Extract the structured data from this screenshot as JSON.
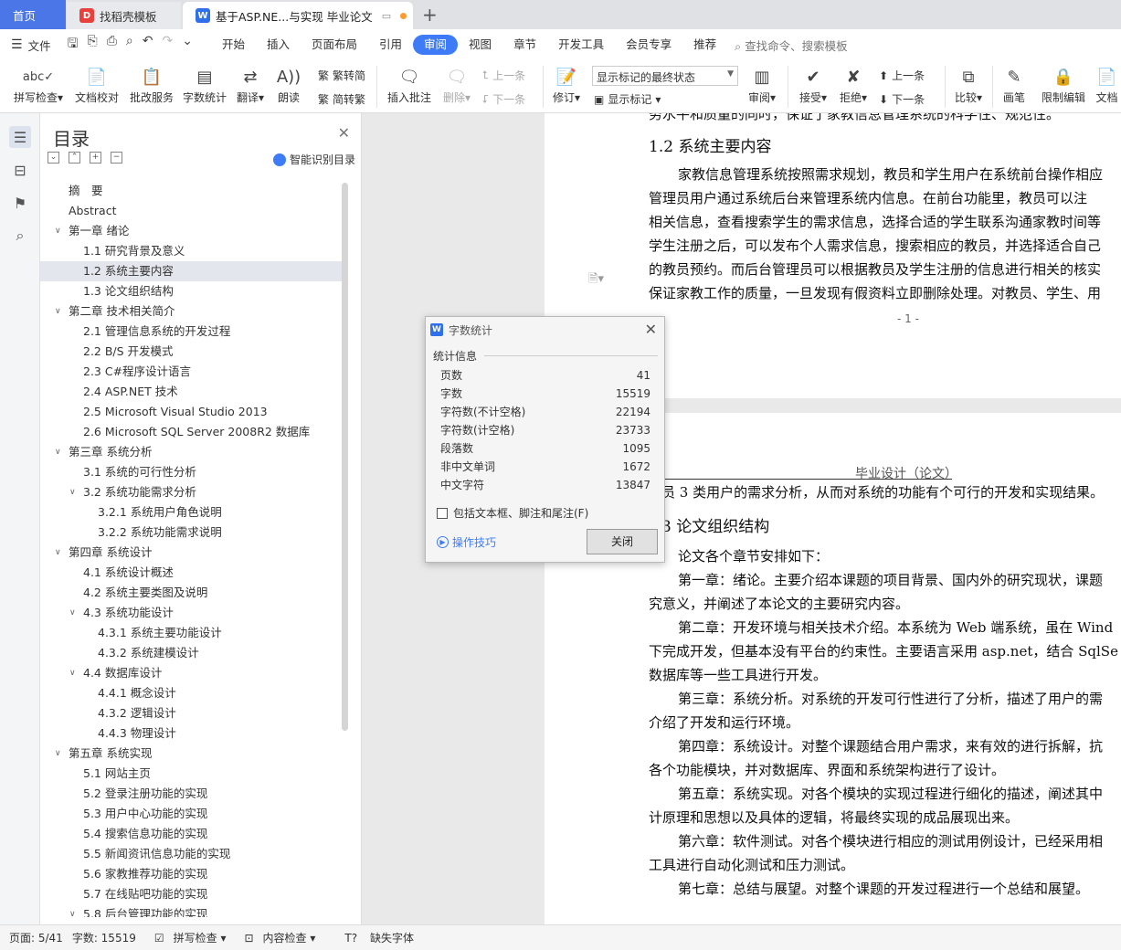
{
  "tabs": {
    "home": "首页",
    "template": "找稻壳模板",
    "doc": "基于ASP.NE...与实现 毕业论文"
  },
  "menu": {
    "file": "文件",
    "items": [
      "开始",
      "插入",
      "页面布局",
      "引用",
      "审阅",
      "视图",
      "章节",
      "开发工具",
      "会员专享",
      "推荐"
    ],
    "active": "审阅",
    "search": "查找命令、搜索模板"
  },
  "ribbon": {
    "spell": "拼写检查",
    "proof": "文档校对",
    "batch": "批改服务",
    "count": "字数统计",
    "translate": "翻译",
    "read": "朗读",
    "trad": "繁转简",
    "simp": "简转繁",
    "comment": "插入批注",
    "delete": "删除",
    "prev1": "上一条",
    "next1": "下一条",
    "revise": "修订",
    "markstate": "显示标记的最终状态",
    "showmark": "显示标记",
    "review": "审阅",
    "accept": "接受",
    "reject": "拒绝",
    "prev2": "上一条",
    "next2": "下一条",
    "compare": "比较",
    "pen": "画笔",
    "restrict": "限制编辑",
    "docx": "文档"
  },
  "toc": {
    "title": "目录",
    "smart": "智能识别目录",
    "items": [
      {
        "label": "摘　要",
        "level": 0,
        "arrow": false
      },
      {
        "label": "Abstract",
        "level": 0,
        "arrow": false
      },
      {
        "label": "第一章  绪论",
        "level": 0,
        "arrow": true
      },
      {
        "label": "1.1 研究背景及意义",
        "level": 1,
        "arrow": false
      },
      {
        "label": "1.2 系统主要内容",
        "level": 1,
        "arrow": false,
        "selected": true
      },
      {
        "label": "1.3 论文组织结构",
        "level": 1,
        "arrow": false
      },
      {
        "label": "第二章  技术相关简介",
        "level": 0,
        "arrow": true
      },
      {
        "label": "2.1 管理信息系统的开发过程",
        "level": 1,
        "arrow": false
      },
      {
        "label": "2.2 B/S  开发模式",
        "level": 1,
        "arrow": false
      },
      {
        "label": "2.3 C#程序设计语言",
        "level": 1,
        "arrow": false
      },
      {
        "label": "2.4 ASP.NET  技术",
        "level": 1,
        "arrow": false
      },
      {
        "label": "2.5 Microsoft Visual Studio 2013",
        "level": 1,
        "arrow": false
      },
      {
        "label": "2.6 Microsoft SQL Server 2008R2 数据库",
        "level": 1,
        "arrow": false
      },
      {
        "label": "第三章  系统分析",
        "level": 0,
        "arrow": true
      },
      {
        "label": "3.1 系统的可行性分析",
        "level": 1,
        "arrow": false
      },
      {
        "label": "3.2 系统功能需求分析",
        "level": 1,
        "arrow": true
      },
      {
        "label": "3.2.1 系统用户角色说明",
        "level": 2,
        "arrow": false
      },
      {
        "label": "3.2.2 系统功能需求说明",
        "level": 2,
        "arrow": false
      },
      {
        "label": "第四章  系统设计",
        "level": 0,
        "arrow": true
      },
      {
        "label": "4.1 系统设计概述",
        "level": 1,
        "arrow": false
      },
      {
        "label": "4.2  系统主要类图及说明",
        "level": 1,
        "arrow": false
      },
      {
        "label": "4.3 系统功能设计",
        "level": 1,
        "arrow": true
      },
      {
        "label": "4.3.1 系统主要功能设计",
        "level": 2,
        "arrow": false
      },
      {
        "label": "4.3.2 系统建模设计",
        "level": 2,
        "arrow": false
      },
      {
        "label": "4.4 数据库设计",
        "level": 1,
        "arrow": true
      },
      {
        "label": "4.4.1  概念设计",
        "level": 2,
        "arrow": false
      },
      {
        "label": "4.3.2  逻辑设计",
        "level": 2,
        "arrow": false
      },
      {
        "label": "4.4.3  物理设计",
        "level": 2,
        "arrow": false
      },
      {
        "label": "第五章  系统实现",
        "level": 0,
        "arrow": true
      },
      {
        "label": "5.1 网站主页",
        "level": 1,
        "arrow": false
      },
      {
        "label": "5.2  登录注册功能的实现",
        "level": 1,
        "arrow": false
      },
      {
        "label": "5.3 用户中心功能的实现",
        "level": 1,
        "arrow": false
      },
      {
        "label": "5.4 搜索信息功能的实现",
        "level": 1,
        "arrow": false
      },
      {
        "label": "5.5 新闻资讯信息功能的实现",
        "level": 1,
        "arrow": false
      },
      {
        "label": "5.6 家教推荐功能的实现",
        "level": 1,
        "arrow": false
      },
      {
        "label": "5.7 在线贴吧功能的实现",
        "level": 1,
        "arrow": false
      },
      {
        "label": "5.8 后台管理功能的实现",
        "level": 1,
        "arrow": true
      }
    ]
  },
  "doc": {
    "p1_top": "务水平和质量的同时，保证了家教信息管理系统的科学性、规范性。",
    "h12": "1.2 系统主要内容",
    "p1_lines": [
      "家教信息管理系统按照需求规划，教员和学生用户在系统前台操作相应",
      "管理员用户通过系统后台来管理系统内信息。在前台功能里，教员可以注",
      "相关信息，查看搜索学生的需求信息，选择合适的学生联系沟通家教时间等",
      "学生注册之后，可以发布个人需求信息，搜索相应的教员，并选择适合自己",
      "的教员预约。而后台管理员可以根据教员及学生注册的信息进行相关的核实",
      "保证家教工作的质量，一旦发现有假资料立即删除处理。对教员、学生、用"
    ],
    "pagenum1": "- 1 -",
    "header2": "毕业设计（论文）",
    "p2_first": "员 3 类用户的需求分析，从而对系统的功能有个可行的开发和实现结果。",
    "h13": "3 论文组织结构",
    "p2_lines": [
      "论文各个章节安排如下：",
      "第一章：绪论。主要介绍本课题的项目背景、国内外的研究现状，课题",
      "究意义，并阐述了本论文的主要研究内容。",
      "第二章：开发环境与相关技术介绍。本系统为 Web 端系统，虽在 Wind",
      "下完成开发，但基本没有平台的约束性。主要语言采用 asp.net，结合 SqlSe",
      "数据库等一些工具进行开发。",
      "第三章：系统分析。对系统的开发可行性进行了分析，描述了用户的需",
      "介绍了开发和运行环境。",
      "第四章：系统设计。对整个课题结合用户需求，来有效的进行拆解，抗",
      "各个功能模块，并对数据库、界面和系统架构进行了设计。",
      "第五章：系统实现。对各个模块的实现过程进行细化的描述，阐述其中",
      "计原理和思想以及具体的逻辑，将最终实现的成品展现出来。",
      "第六章：软件测试。对各个模块进行相应的测试用例设计，已经采用相",
      "工具进行自动化测试和压力测试。",
      "第七章：总结与展望。对整个课题的开发过程进行一个总结和展望。"
    ]
  },
  "dialog": {
    "title": "字数统计",
    "section": "统计信息",
    "stats": [
      {
        "label": "页数",
        "value": "41"
      },
      {
        "label": "字数",
        "value": "15519"
      },
      {
        "label": "字符数(不计空格)",
        "value": "22194"
      },
      {
        "label": "字符数(计空格)",
        "value": "23733"
      },
      {
        "label": "段落数",
        "value": "1095"
      },
      {
        "label": "非中文单词",
        "value": "1672"
      },
      {
        "label": "中文字符",
        "value": "13847"
      }
    ],
    "checkbox": "包括文本框、脚注和尾注(F)",
    "tips": "操作技巧",
    "close": "关闭"
  },
  "status": {
    "page": "页面: 5/41",
    "words": "字数: 15519",
    "spell": "拼写检查",
    "content": "内容检查",
    "font": "缺失字体"
  }
}
